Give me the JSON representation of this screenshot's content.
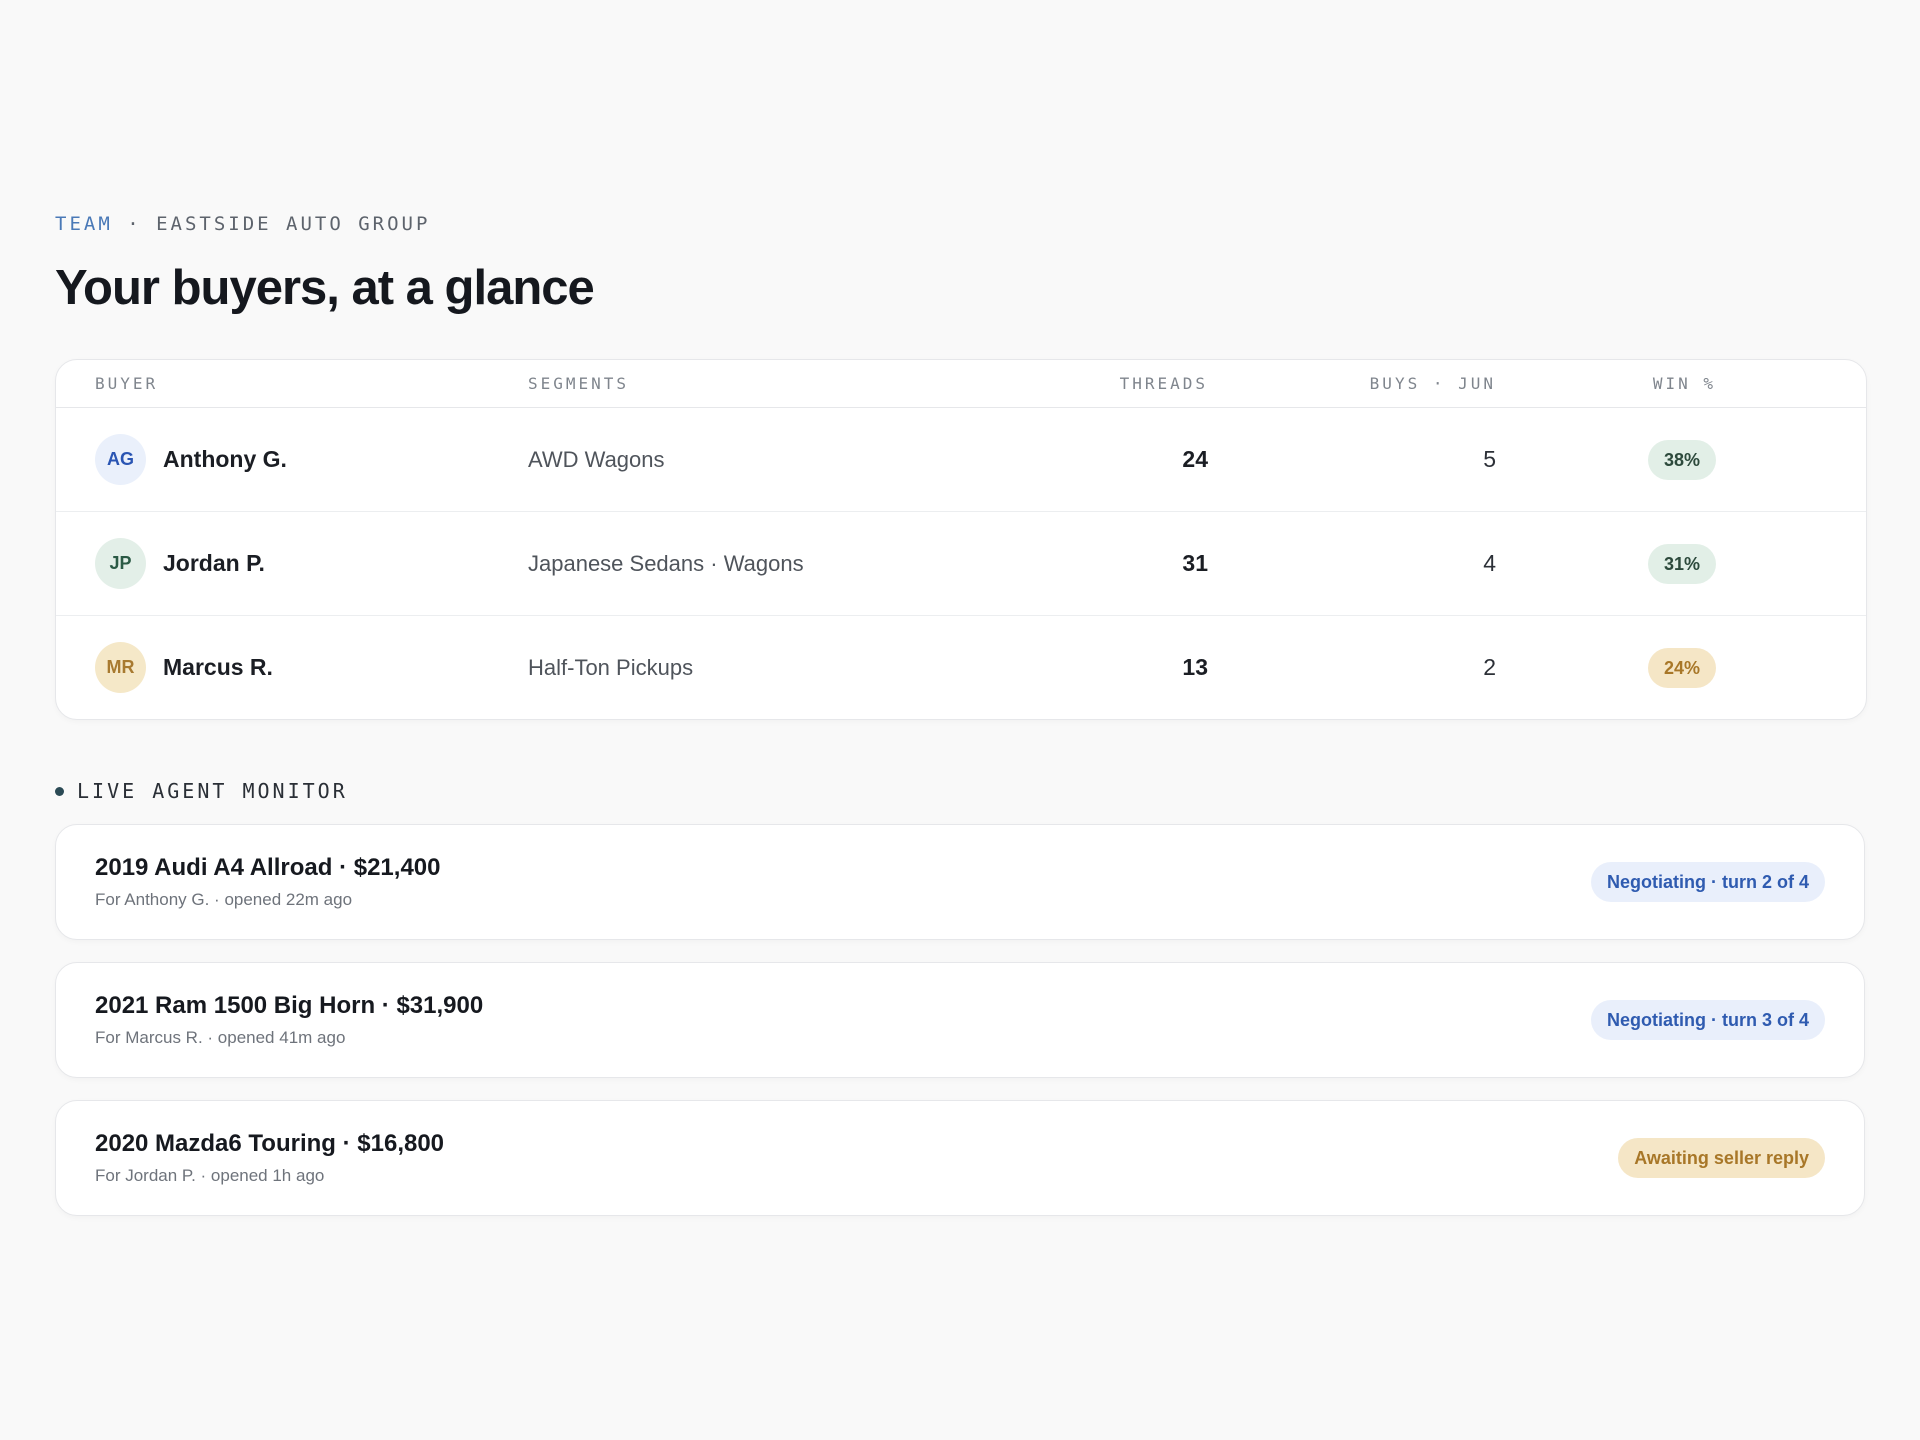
{
  "header": {
    "eyebrow_team": "TEAM",
    "eyebrow_sep": " · ",
    "eyebrow_org": "EASTSIDE AUTO GROUP",
    "title": "Your buyers, at a glance"
  },
  "table": {
    "columns": [
      "BUYER",
      "SEGMENTS",
      "THREADS",
      "BUYS · JUN",
      "WIN %"
    ],
    "rows": [
      {
        "initials": "AG",
        "name": "Anthony G.",
        "segments": "AWD Wagons",
        "threads": "24",
        "buys": "5",
        "win": "38%"
      },
      {
        "initials": "JP",
        "name": "Jordan P.",
        "segments": "Japanese Sedans · Wagons",
        "threads": "31",
        "buys": "4",
        "win": "31%"
      },
      {
        "initials": "MR",
        "name": "Marcus R.",
        "segments": "Half-Ton Pickups",
        "threads": "13",
        "buys": "2",
        "win": "24%"
      }
    ]
  },
  "monitor": {
    "title": "LIVE AGENT MONITOR",
    "deals": [
      {
        "title": "2019 Audi A4 Allroad · $21,400",
        "meta": "For Anthony G. · opened 22m ago",
        "status": "Negotiating · turn 2 of 4"
      },
      {
        "title": "2021 Ram 1500 Big Horn · $31,900",
        "meta": "For Marcus R. · opened 41m ago",
        "status": "Negotiating · turn 3 of 4"
      },
      {
        "title": "2020 Mazda6 Touring · $16,800",
        "meta": "For Jordan P. · opened 1h ago",
        "status": "Awaiting seller reply"
      }
    ]
  },
  "colors": {
    "accent_blue": "#2f5bb0",
    "status_green": "#2d4a3c",
    "status_gold": "#a87728",
    "background": "#f9f9f9"
  }
}
